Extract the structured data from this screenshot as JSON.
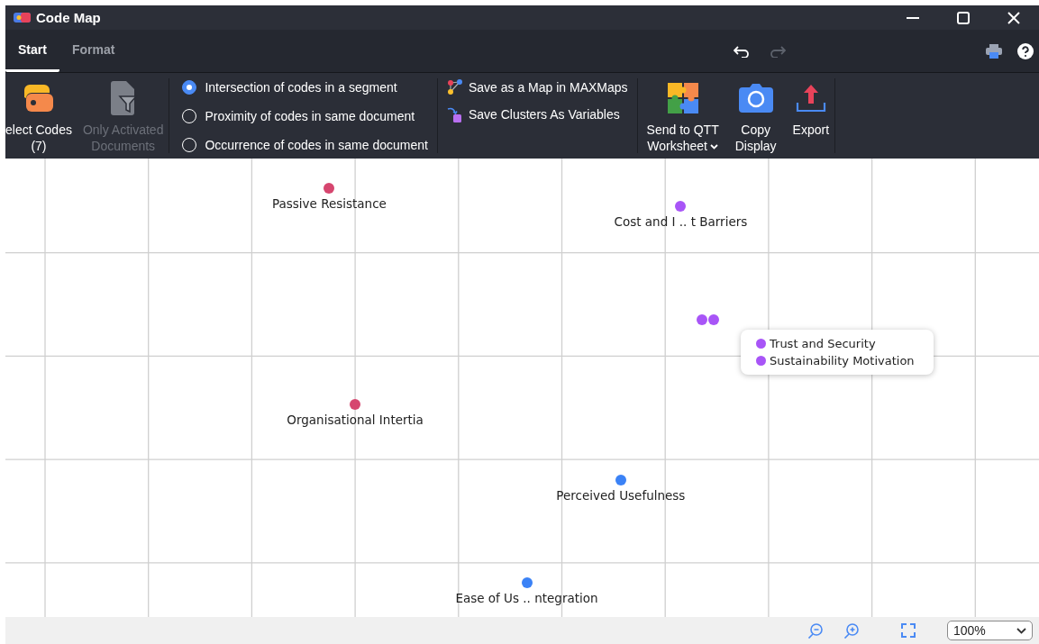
{
  "window": {
    "title": "Code Map"
  },
  "tabs": [
    {
      "label": "Start",
      "selected": true
    },
    {
      "label": "Format",
      "selected": false
    }
  ],
  "history": {
    "undo": {
      "disabled": false
    },
    "redo": {
      "disabled": true
    }
  },
  "ribbon": {
    "select_codes": {
      "lines": [
        "elect Codes",
        "(7)"
      ],
      "disabled": false
    },
    "only_activated": {
      "lines": [
        "Only Activated",
        "Documents"
      ],
      "disabled": true
    },
    "modes": [
      {
        "label": "Intersection of codes in a segment",
        "selected": true
      },
      {
        "label": "Proximity of codes in same document",
        "selected": false
      },
      {
        "label": "Occurrence of codes in same document",
        "selected": false
      }
    ],
    "save_actions": [
      {
        "kind": "maxmaps",
        "label": "Save as a Map in MAXMaps"
      },
      {
        "kind": "variables",
        "label": "Save Clusters As Variables"
      }
    ],
    "big_buttons": [
      {
        "kind": "qtt",
        "lines": [
          "Send to QTT",
          "Worksheet"
        ],
        "dropdown": true
      },
      {
        "kind": "camera",
        "lines": [
          "Copy",
          "Display"
        ],
        "dropdown": false
      },
      {
        "kind": "export",
        "lines": [
          "Export"
        ],
        "dropdown": false
      }
    ]
  },
  "map": {
    "codes": [
      {
        "label": "Passive Resistance",
        "color": "#d6466f"
      },
      {
        "label": "Cost and I .. t Barriers",
        "color": "#a855f7"
      },
      {
        "color": "#a855f7"
      },
      {
        "color": "#a855f7"
      },
      {
        "label": "Organisational Intertia",
        "color": "#d6466f"
      },
      {
        "label": "Perceived Usefulness",
        "color": "#3b82f6"
      },
      {
        "label": "Ease of Us .. ntegration",
        "color": "#3b82f6"
      }
    ],
    "tooltip": {
      "items": [
        {
          "label": "Trust and Security",
          "color": "#a855f7"
        },
        {
          "label": "Sustainability Motivation",
          "color": "#a855f7"
        }
      ]
    }
  },
  "zoom": {
    "value": "100%"
  }
}
